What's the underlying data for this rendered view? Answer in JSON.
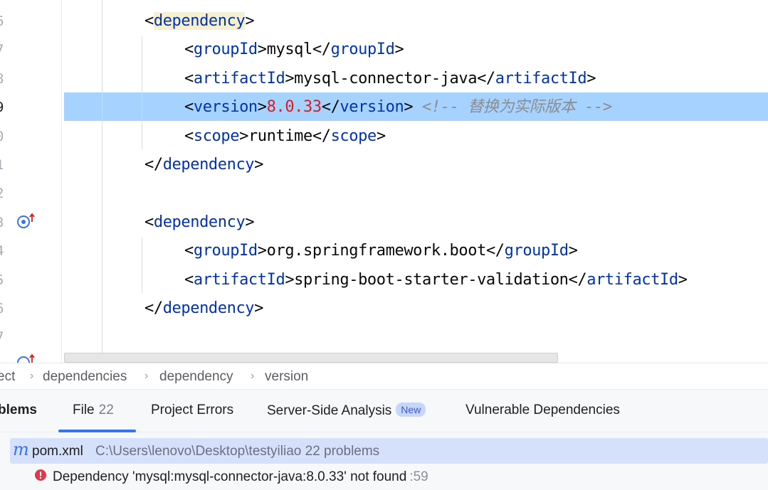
{
  "gutter": {
    "line_numbers": [
      "6",
      "7",
      "8",
      "9",
      "0",
      "1",
      "2",
      "3",
      "4",
      "5",
      "6",
      "7"
    ],
    "current_line_index": 3
  },
  "code": {
    "lines": [
      {
        "parts": [
          {
            "t": "<",
            "c": "br"
          },
          {
            "t": "dependency",
            "c": "tag hl"
          },
          {
            "t": ">",
            "c": "br"
          }
        ]
      },
      {
        "parts": [
          {
            "t": "<",
            "c": "br"
          },
          {
            "t": "groupId",
            "c": "tag"
          },
          {
            "t": ">",
            "c": "br"
          },
          {
            "t": "mysql",
            "c": "txt"
          },
          {
            "t": "</",
            "c": "br"
          },
          {
            "t": "groupId",
            "c": "tag"
          },
          {
            "t": ">",
            "c": "br"
          }
        ]
      },
      {
        "parts": [
          {
            "t": "<",
            "c": "br"
          },
          {
            "t": "artifactId",
            "c": "tag"
          },
          {
            "t": ">",
            "c": "br"
          },
          {
            "t": "mysql-connector-java",
            "c": "txt"
          },
          {
            "t": "</",
            "c": "br"
          },
          {
            "t": "artifactId",
            "c": "tag"
          },
          {
            "t": ">",
            "c": "br"
          }
        ]
      },
      {
        "parts": [
          {
            "t": "<",
            "c": "br"
          },
          {
            "t": "version",
            "c": "tag"
          },
          {
            "t": ">",
            "c": "br"
          },
          {
            "t": "8.0.33",
            "c": "num"
          },
          {
            "t": "</",
            "c": "br"
          },
          {
            "t": "version",
            "c": "tag"
          },
          {
            "t": ">",
            "c": "br"
          },
          {
            "t": " <!-- 替换为实际版本 -->",
            "c": "cmt"
          }
        ]
      },
      {
        "parts": [
          {
            "t": "<",
            "c": "br"
          },
          {
            "t": "scope",
            "c": "tag"
          },
          {
            "t": ">",
            "c": "br"
          },
          {
            "t": "runtime",
            "c": "txt"
          },
          {
            "t": "</",
            "c": "br"
          },
          {
            "t": "scope",
            "c": "tag"
          },
          {
            "t": ">",
            "c": "br"
          }
        ]
      },
      {
        "parts": [
          {
            "t": "</",
            "c": "br"
          },
          {
            "t": "dependency",
            "c": "tag"
          },
          {
            "t": ">",
            "c": "br"
          }
        ]
      },
      {
        "parts": []
      },
      {
        "parts": [
          {
            "t": "<",
            "c": "br"
          },
          {
            "t": "dependency",
            "c": "tag"
          },
          {
            "t": ">",
            "c": "br"
          }
        ]
      },
      {
        "parts": [
          {
            "t": "<",
            "c": "br"
          },
          {
            "t": "groupId",
            "c": "tag"
          },
          {
            "t": ">",
            "c": "br"
          },
          {
            "t": "org.springframework.boot",
            "c": "txt"
          },
          {
            "t": "</",
            "c": "br"
          },
          {
            "t": "groupId",
            "c": "tag"
          },
          {
            "t": ">",
            "c": "br"
          }
        ]
      },
      {
        "parts": [
          {
            "t": "<",
            "c": "br"
          },
          {
            "t": "artifactId",
            "c": "tag"
          },
          {
            "t": ">",
            "c": "br"
          },
          {
            "t": "spring-boot-starter-validation",
            "c": "txt"
          },
          {
            "t": "</",
            "c": "br"
          },
          {
            "t": "artifactId",
            "c": "tag"
          },
          {
            "t": ">",
            "c": "br"
          }
        ]
      },
      {
        "parts": [
          {
            "t": "</",
            "c": "br"
          },
          {
            "t": "dependency",
            "c": "tag"
          },
          {
            "t": ">",
            "c": "br"
          }
        ]
      },
      {
        "parts": []
      }
    ]
  },
  "breadcrumb": {
    "items": [
      "ect",
      "dependencies",
      "dependency",
      "version"
    ],
    "separator": "›"
  },
  "problems": {
    "title": "blems",
    "tabs": [
      {
        "label": "File",
        "count": "22"
      },
      {
        "label": "Project Errors"
      },
      {
        "label": "Server-Side Analysis",
        "badge": "New"
      },
      {
        "label": "Vulnerable Dependencies"
      }
    ],
    "file": {
      "icon": "m",
      "name": "pom.xml",
      "path": "C:\\Users\\lenovo\\Desktop\\testyiliao",
      "count": "22 problems"
    },
    "error": {
      "message": "Dependency 'mysql:mysql-connector-java:8.0.33' not found",
      "line": ":59"
    }
  },
  "colors": {
    "current_line": "#a6d2ff",
    "tag": "#0033b3",
    "number": "#e01b1b",
    "comment": "#8c8c8c",
    "accent": "#3574f0",
    "error": "#db3b4b"
  }
}
